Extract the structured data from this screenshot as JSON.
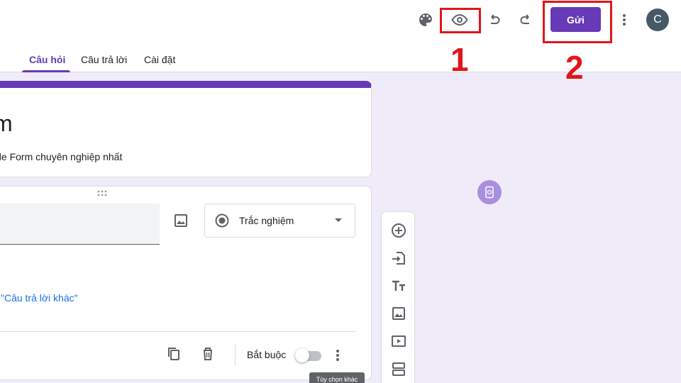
{
  "header": {
    "send_label": "Gửi",
    "avatar_initial": "C",
    "icons": [
      "palette-icon",
      "eye-icon",
      "undo-icon",
      "redo-icon",
      "more-vert-icon"
    ]
  },
  "annotations": {
    "label_1": "1",
    "label_2": "2"
  },
  "tabs": [
    {
      "label": "Câu hỏi",
      "active": true
    },
    {
      "label": "Câu trả lời",
      "active": false
    },
    {
      "label": "Cài đặt",
      "active": false
    }
  ],
  "form": {
    "title": "m",
    "description": "gle Form chuyên nghiệp nhất"
  },
  "question": {
    "type_label": "Trắc nghiệm",
    "add_other_text": "\"Câu trả lời khác\"",
    "required_label": "Bắt buộc",
    "required": false,
    "tooltip": "Tùy chọn khác"
  },
  "side_toolbar": {
    "items": [
      "add-question-icon",
      "import-questions-icon",
      "add-title-icon",
      "add-image-icon",
      "add-video-icon",
      "add-section-icon"
    ]
  },
  "colors": {
    "accent": "#673ab7",
    "background": "#f0ebf8",
    "annotation_red": "#e0161c",
    "link_blue": "#1a73e8"
  }
}
